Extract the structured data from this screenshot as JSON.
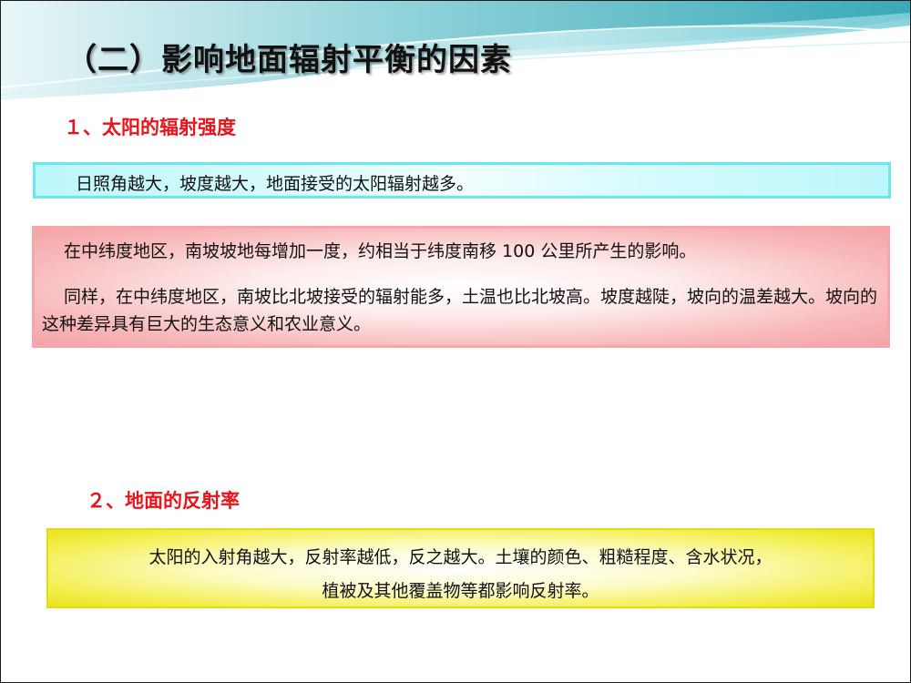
{
  "slide": {
    "title": "（二）影响地面辐射平衡的因素",
    "section1": {
      "heading": "１、太阳的辐射强度",
      "box1_text": "日照角越大，坡度越大，地面接受的太阳辐射越多。",
      "box2_p1": "在中纬度地区，南坡坡地每增加一度，约相当于纬度南移 100 公里所产生的影响。",
      "box2_p2": "同样，在中纬度地区，南坡比北坡接受的辐射能多，土温也比北坡高。坡度越陡，坡向的温差越大。坡向的这种差异具有巨大的生态意义和农业意义。"
    },
    "section2": {
      "heading": "２、地面的反射率",
      "box_line1": "太阳的入射角越大，反射率越低，反之越大。土壤的颜色、粗糙程度、含水状况，",
      "box_line2": "植被及其他覆盖物等都影响反射率。"
    }
  },
  "colors": {
    "heading_red": "#e8141b",
    "cyan_box": "#bdf7fb",
    "pink_box": "#f8b9bb",
    "yellow_box": "#f3ee4a",
    "decor_teal": "#5fbcc6"
  }
}
